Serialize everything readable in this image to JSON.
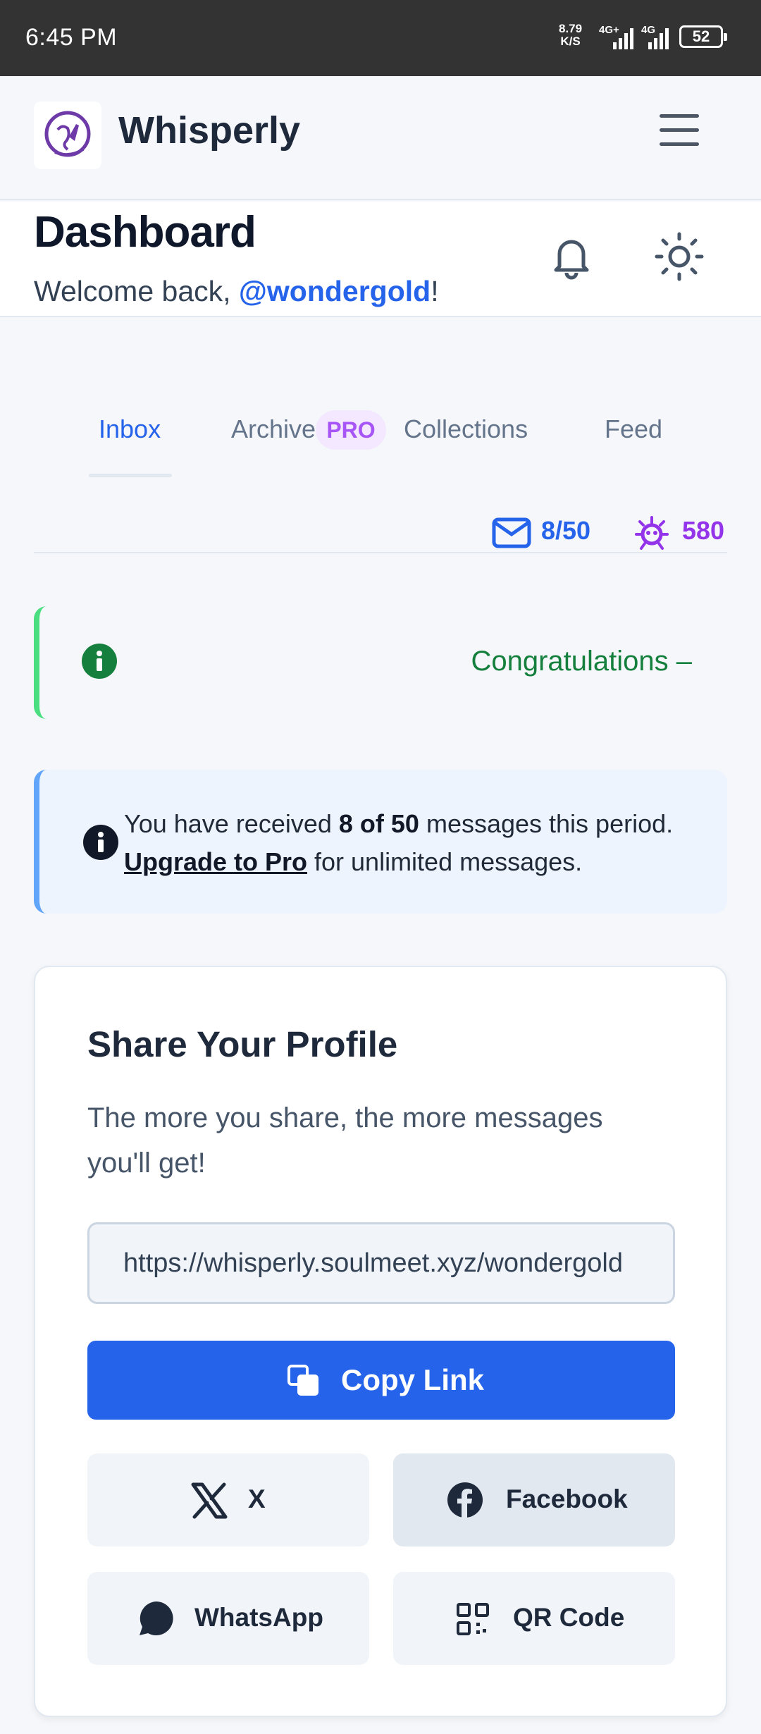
{
  "status_bar": {
    "time": "6:45 PM",
    "net_rate": "8.79",
    "net_unit": "K/S",
    "net1": "4G+",
    "net2": "4G",
    "battery": "52"
  },
  "app": {
    "name": "Whisperly"
  },
  "dashboard": {
    "title": "Dashboard",
    "welcome_prefix": "Welcome back, ",
    "username": "@wondergold",
    "welcome_suffix": "!"
  },
  "tabs": [
    {
      "label": "Inbox",
      "active": true
    },
    {
      "label": "Archive",
      "badge": "PRO"
    },
    {
      "label": "Collections"
    },
    {
      "label": "Feed"
    }
  ],
  "stats": {
    "messages": "8/50",
    "points": "580",
    "colors": {
      "messages": "#2563eb",
      "points": "#9333ea"
    }
  },
  "alerts": {
    "congrats": "Congratulations –",
    "info_prefix": "You have received ",
    "info_bold": "8 of 50",
    "info_mid": " messages this period.",
    "info_link": "Upgrade to Pro",
    "info_suffix": " for unlimited messages."
  },
  "share": {
    "title": "Share Your Profile",
    "subtitle": "The more you share, the more messages you'll get!",
    "url": "https://whisperly.soulmeet.xyz/wondergold",
    "copy_label": "Copy Link",
    "buttons": [
      {
        "label": "X",
        "icon": "x-logo-icon"
      },
      {
        "label": "Facebook",
        "icon": "facebook-icon"
      },
      {
        "label": "WhatsApp",
        "icon": "chat-bubble-icon"
      },
      {
        "label": "QR Code",
        "icon": "qr-code-icon"
      }
    ]
  }
}
